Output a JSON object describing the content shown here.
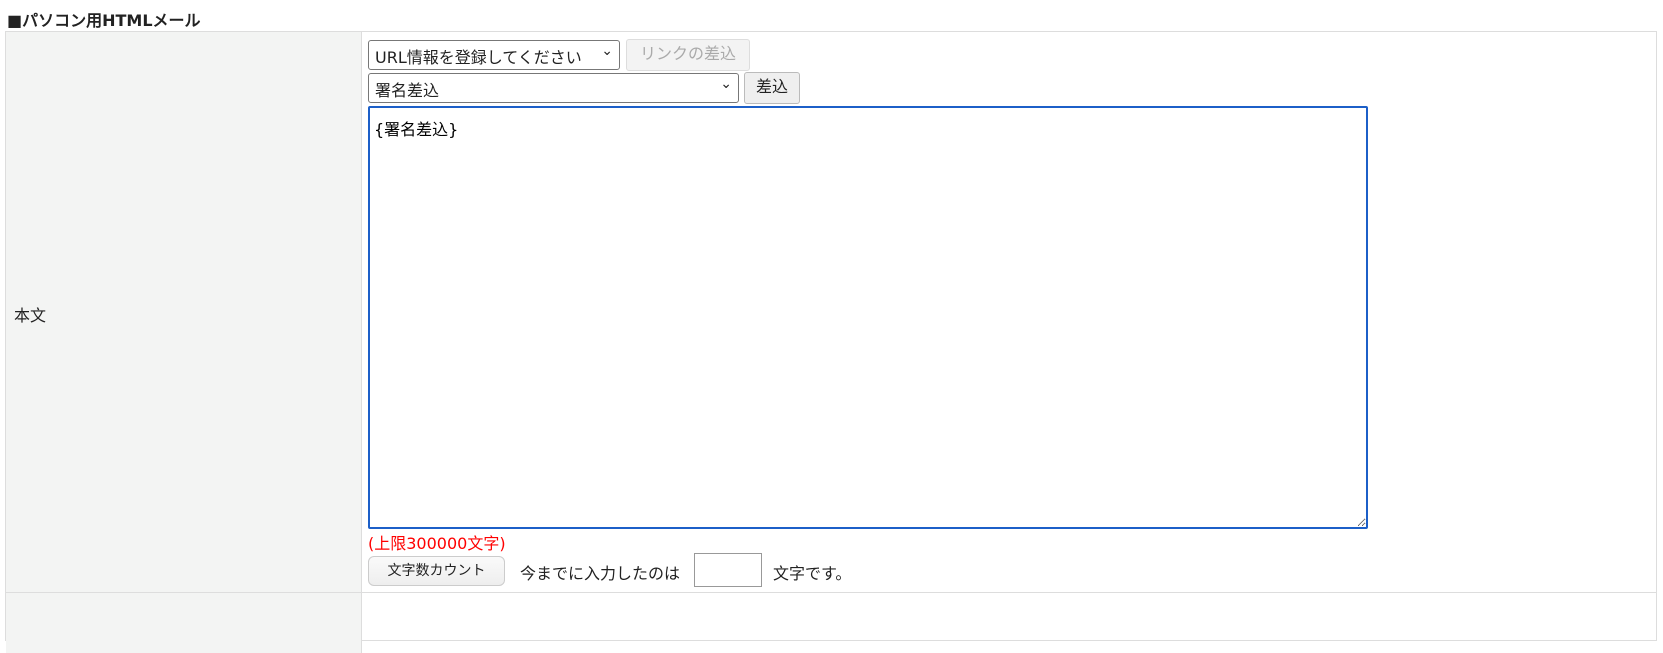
{
  "section_title": "■パソコン用HTMLメール",
  "row_label": "本文",
  "url_select": {
    "value": "URL情報を登録してください"
  },
  "link_insert_button": "リンクの差込",
  "signature_select": {
    "value": "署名差込"
  },
  "insert_button": "差込",
  "body_textarea": {
    "value": "{署名差込}"
  },
  "limit_note": "(上限300000文字)",
  "count_button": "文字数カウント",
  "count_prefix": "今までに入力したのは",
  "count_value": "",
  "count_suffix": "文字です。"
}
